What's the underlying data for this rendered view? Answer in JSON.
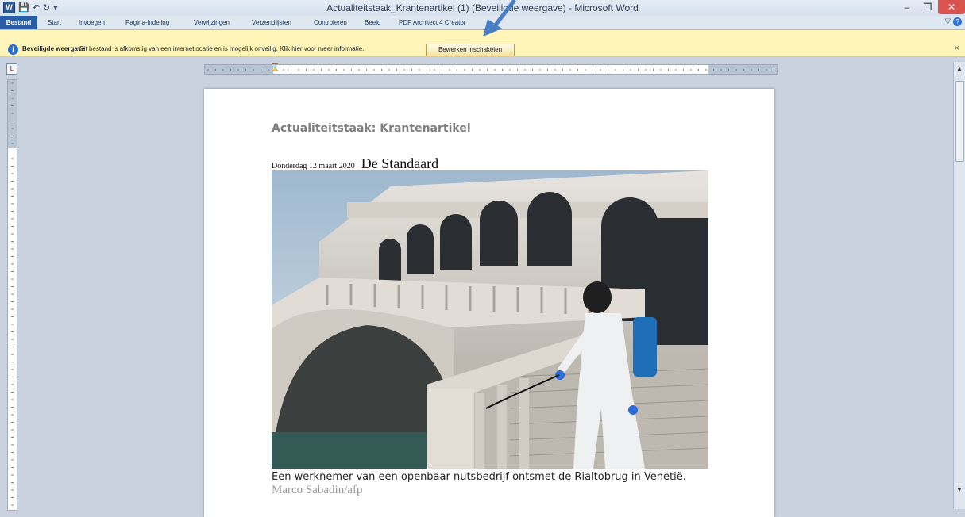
{
  "window": {
    "title": "Actualiteitstaak_Krantenartikel (1) (Beveiligde weergave) - Microsoft Word",
    "app_icon": "W",
    "controls": [
      "–",
      "❐",
      "✕"
    ]
  },
  "ribbon": {
    "tabs": [
      "Bestand",
      "Start",
      "Invoegen",
      "Pagina-indeling",
      "Verwijzingen",
      "Verzendlijsten",
      "Controleren",
      "Beeld",
      "PDF Architect 4 Creator"
    ]
  },
  "protected_view": {
    "title": "Beveiligde weergave",
    "message": "Dit bestand is afkomstig van een internetlocatie en is mogelijk onveilig. Klik hier voor meer informatie.",
    "button_label": "Bewerken inschakelen"
  },
  "document": {
    "heading": "Actualiteitstaak: Krantenartikel",
    "date": "Donderdag 12 maart 2020",
    "newspaper": "De Standaard",
    "caption": "Een werknemer van een openbaar nutsbedrijf ontsmet de Rialtobrug in Venetië.",
    "credit": "Marco Sabadin/afp"
  },
  "colors": {
    "file_tab": "#2a5da8",
    "protected_bar": "#fff5b8",
    "close_button": "#d9534f",
    "annotation_arrow": "#4a7fc6"
  }
}
